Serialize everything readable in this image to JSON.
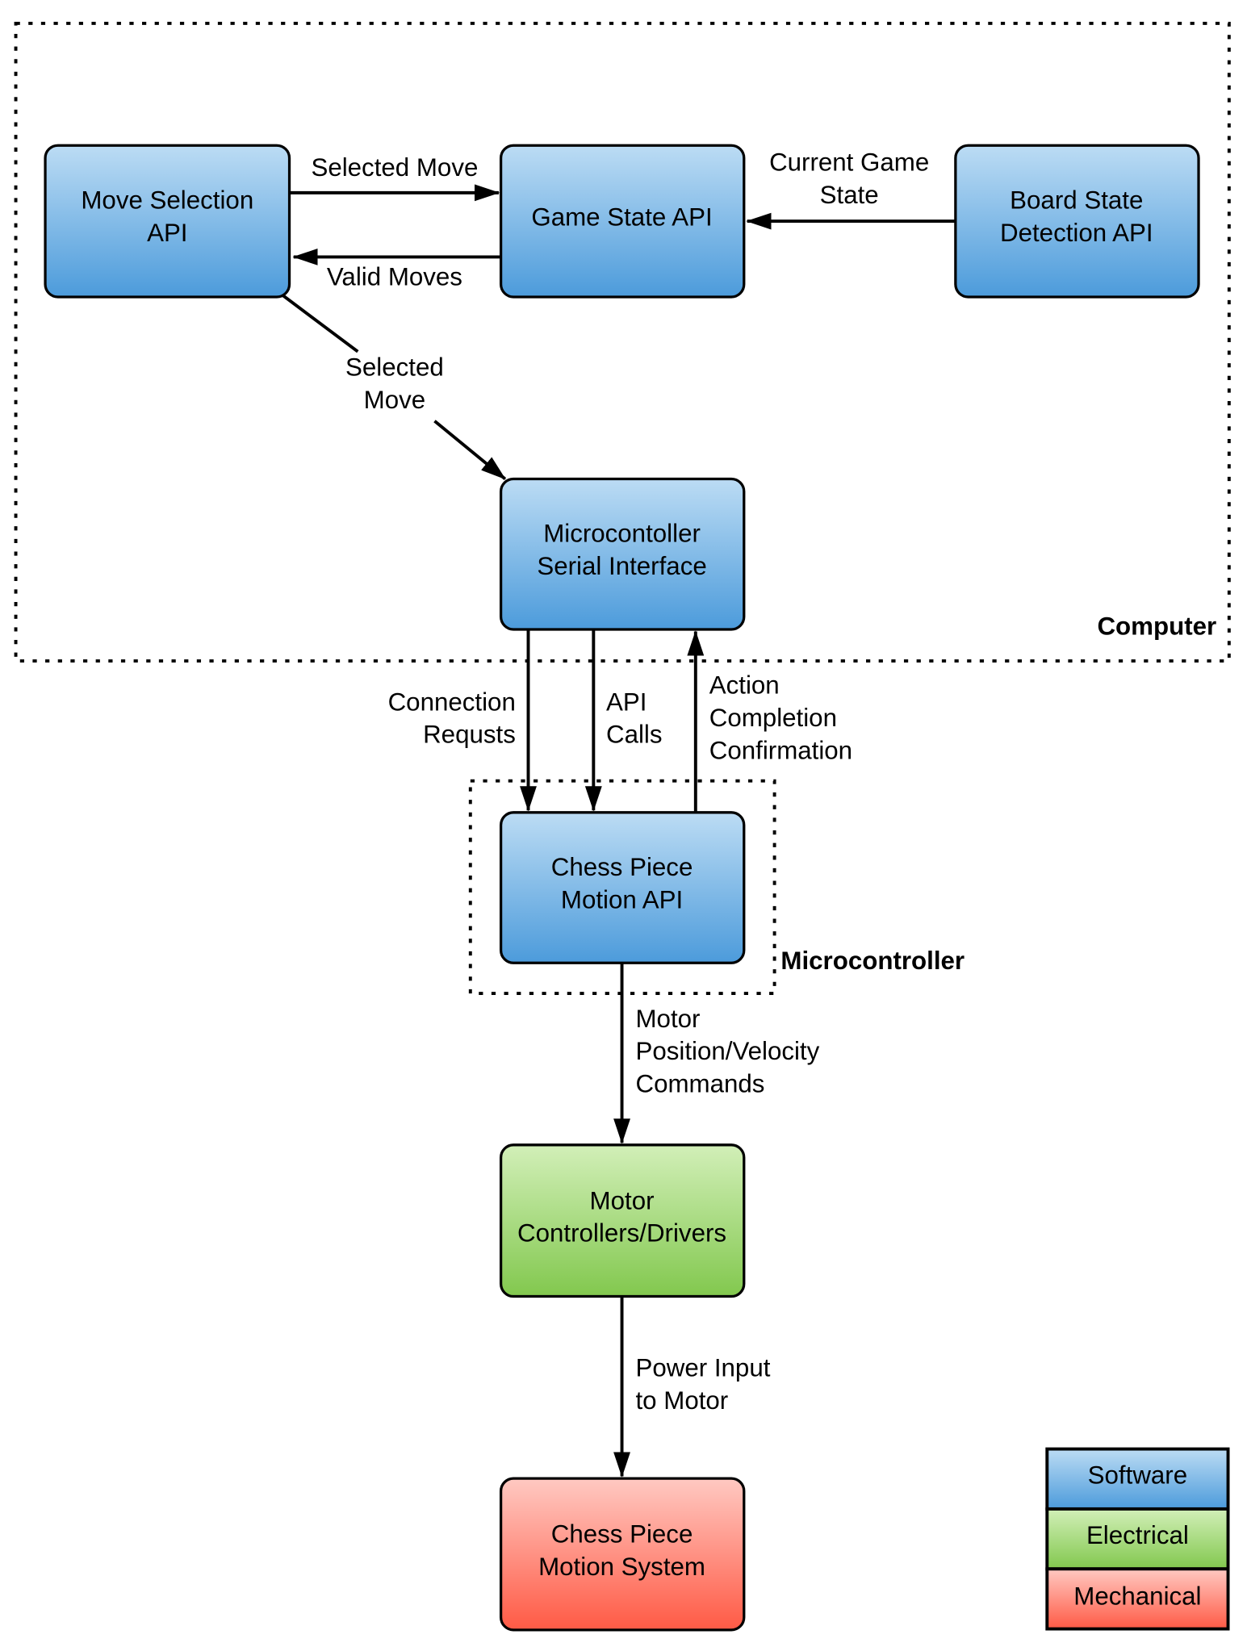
{
  "colors": {
    "software": [
      "#bcdcf4",
      "#4c9bdb"
    ],
    "electrical": [
      "#d2efb8",
      "#82c84e"
    ],
    "mechanical": [
      "#ffc9c2",
      "#ff5a45"
    ]
  },
  "groups": {
    "computer": "Computer",
    "microcontroller": "Microcontroller"
  },
  "nodes": {
    "move_selection": [
      "Move Selection",
      "API"
    ],
    "game_state": [
      "Game State API"
    ],
    "board_state": [
      "Board State",
      "Detection API"
    ],
    "serial_interface": [
      "Microcontoller",
      "Serial Interface"
    ],
    "motion_api": [
      "Chess Piece",
      "Motion API"
    ],
    "motor_controllers": [
      "Motor",
      "Controllers/Drivers"
    ],
    "motion_system": [
      "Chess Piece",
      "Motion System"
    ]
  },
  "edges": {
    "selected_move_1": [
      "Selected Move"
    ],
    "valid_moves": [
      "Valid Moves"
    ],
    "current_game_state": [
      "Current Game",
      "State"
    ],
    "selected_move_2": [
      "Selected",
      "Move"
    ],
    "connection_requests": [
      "Connection",
      "Requsts"
    ],
    "api_calls": [
      "API",
      "Calls"
    ],
    "action_completion": [
      "Action",
      "Completion",
      "Confirmation"
    ],
    "motor_commands": [
      "Motor",
      "Position/Velocity",
      "Commands"
    ],
    "power_input": [
      "Power Input",
      "to Motor"
    ]
  },
  "legend": [
    "Software",
    "Electrical",
    "Mechanical"
  ]
}
